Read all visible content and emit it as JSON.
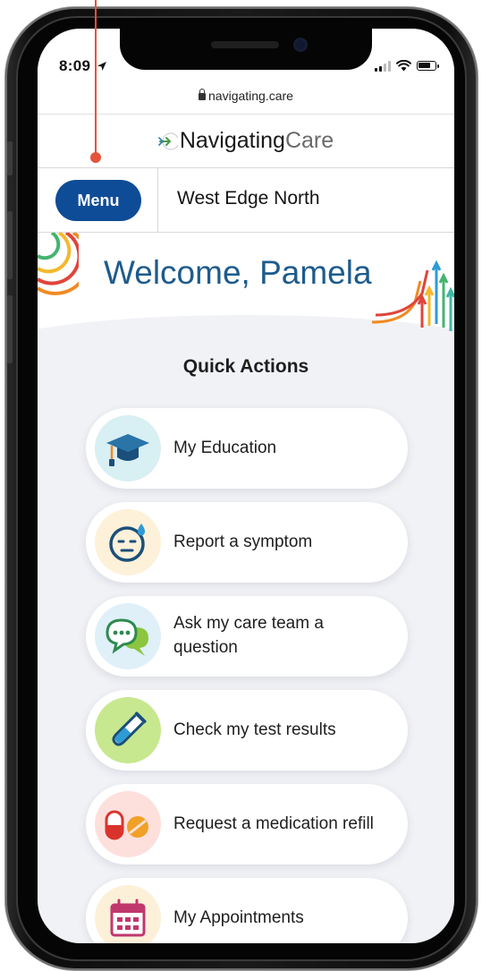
{
  "status_bar": {
    "time": "8:09",
    "location_arrow_icon": "location-arrow-icon",
    "signal_icon": "cellular-signal-icon",
    "wifi_icon": "wifi-icon",
    "battery_icon": "battery-icon"
  },
  "browser": {
    "url": "navigating.care",
    "lock_icon": "lock-icon"
  },
  "brand": {
    "logo_icon": "navigating-care-logo-icon",
    "name_part1": "Navigating",
    "name_part2": "Care"
  },
  "nav": {
    "menu_label": "Menu",
    "location": "West Edge North"
  },
  "welcome": {
    "greeting": "Welcome, Pamela"
  },
  "quick_actions": {
    "title": "Quick Actions",
    "items": [
      {
        "label": "My Education",
        "icon": "graduation-cap-icon",
        "bg": "#d8eff3"
      },
      {
        "label": "Report a symptom",
        "icon": "symptom-face-icon",
        "bg": "#fdf1d9"
      },
      {
        "label": "Ask my care team a question",
        "icon": "chat-bubbles-icon",
        "bg": "#dff0f9"
      },
      {
        "label": "Check my test results",
        "icon": "test-tube-icon",
        "bg": "#dff2b9"
      },
      {
        "label": "Request a medication refill",
        "icon": "pills-icon",
        "bg": "#fde0dc"
      },
      {
        "label": "My Appointments",
        "icon": "calendar-icon",
        "bg": "#fdf0d9"
      }
    ]
  },
  "colors": {
    "primary": "#0f4c97",
    "welcome_text": "#1e5b8c",
    "background": "#f1f2f6",
    "pointer": "#e5533b"
  }
}
